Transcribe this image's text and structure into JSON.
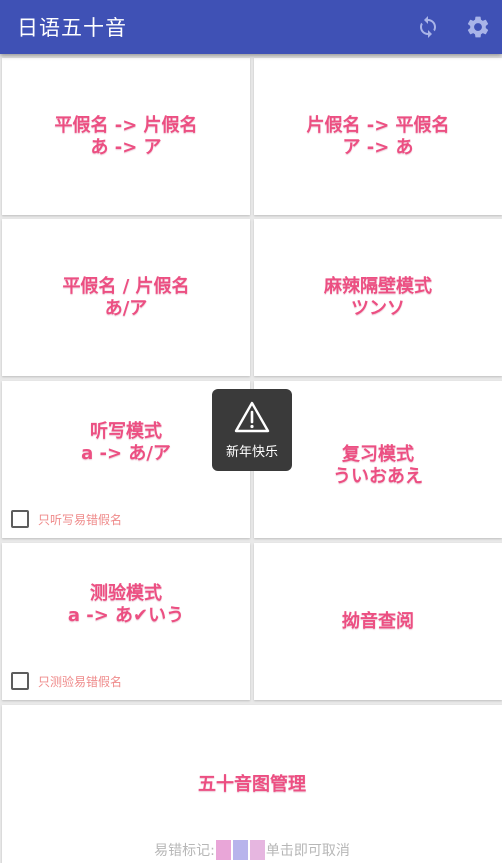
{
  "app": {
    "title": "日语五十音"
  },
  "toolbar": {
    "sync_icon": "sync-icon",
    "settings_icon": "gear-icon"
  },
  "colors": {
    "primary": "#3f51b5",
    "accent": "#ec4f82",
    "checkbox_label": "#ef8a8a"
  },
  "cards": [
    {
      "name": "hiragana-to-katakana",
      "line1": "平假名 -> 片假名",
      "line2": "あ -> ア"
    },
    {
      "name": "katakana-to-hiragana",
      "line1": "片假名 -> 平假名",
      "line2": "ア -> あ"
    },
    {
      "name": "hiragana-katakana",
      "line1": "平假名 / 片假名",
      "line2": "あ/ア"
    },
    {
      "name": "trouble-mode",
      "line1": "麻辣隔壁模式",
      "line2": "ツンソ"
    },
    {
      "name": "dictation-mode",
      "line1": "听写模式",
      "line2": "a -> あ/ア",
      "checkbox_label": "只听写易错假名"
    },
    {
      "name": "review-mode",
      "line1": "复习模式",
      "line2": "ういおあえ"
    },
    {
      "name": "quiz-mode",
      "line1": "测验模式",
      "line2": "a -> あ✔いう",
      "checkbox_label": "只测验易错假名"
    },
    {
      "name": "youon-lookup",
      "line1": "拗音查阅"
    },
    {
      "name": "gojuon-management",
      "line1": "五十音图管理"
    }
  ],
  "legend": {
    "prefix": "易错标记:",
    "suffix": "单击即可取消",
    "swatches": [
      "#e9a6d8",
      "#b8b4ec",
      "#e6b6e0"
    ]
  },
  "toast": {
    "icon": "warning-icon",
    "text": "新年快乐"
  }
}
